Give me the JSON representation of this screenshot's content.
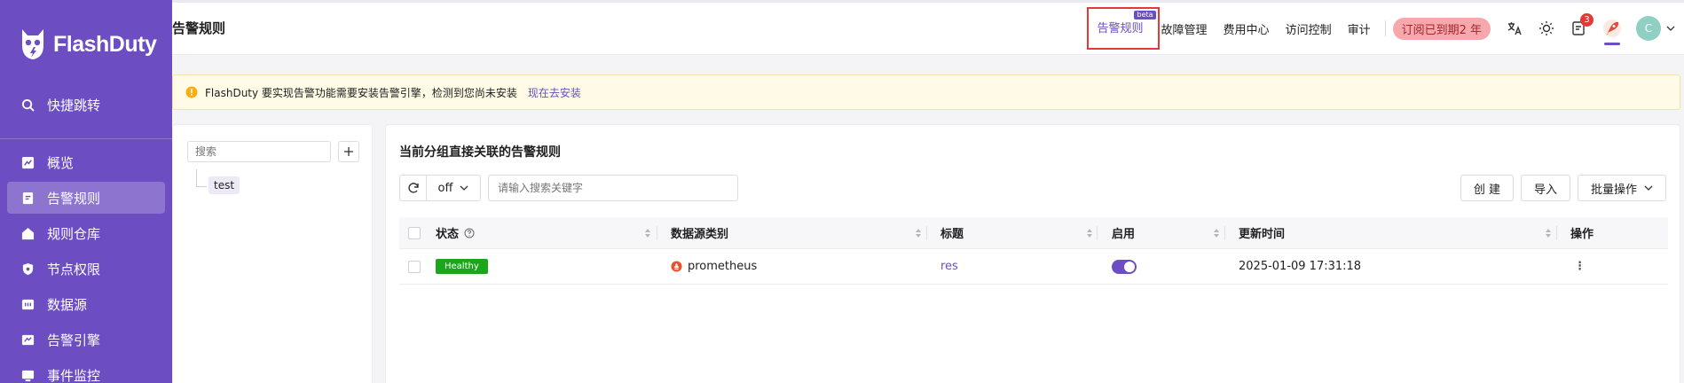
{
  "brand": {
    "name": "FlashDuty"
  },
  "sidebar": {
    "search_label": "快捷跳转",
    "items": [
      {
        "label": "概览",
        "icon": "chart-icon"
      },
      {
        "label": "告警规则",
        "icon": "rule-doc-icon",
        "active": true
      },
      {
        "label": "规则仓库",
        "icon": "warehouse-icon"
      },
      {
        "label": "节点权限",
        "icon": "shield-icon"
      },
      {
        "label": "数据源",
        "icon": "datasource-icon"
      },
      {
        "label": "告警引擎",
        "icon": "engine-icon"
      },
      {
        "label": "事件监控",
        "icon": "monitor-icon"
      }
    ]
  },
  "header": {
    "title": "告警规则",
    "nav": {
      "alert_rules": "告警规则",
      "beta": "beta",
      "incident_mgmt": "故障管理",
      "billing": "费用中心",
      "access_control": "访问控制",
      "audit": "审计"
    },
    "subscription": "订阅已到期2 年",
    "notification_count": "3",
    "user_initial": "C"
  },
  "alert": {
    "message": "FlashDuty 要实现告警功能需要安装告警引擎，检测到您尚未安装",
    "link": "现在去安装"
  },
  "tree": {
    "search_placeholder": "搜索",
    "nodes": [
      "test"
    ]
  },
  "main": {
    "title": "当前分组直接关联的告警规则",
    "refresh_select": "off",
    "search_placeholder": "请输入搜索关键字",
    "buttons": {
      "create": "创 建",
      "import": "导入",
      "batch": "批量操作"
    },
    "columns": {
      "status": "状态",
      "datasource_type": "数据源类别",
      "title": "标题",
      "enabled": "启用",
      "updated_at": "更新时间",
      "actions": "操作"
    },
    "rows": [
      {
        "status": "Healthy",
        "datasource": "prometheus",
        "title": "res",
        "enabled": true,
        "updated_at": "2025-01-09 17:31:18",
        "action": "⋮"
      }
    ]
  },
  "colors": {
    "brand_purple": "#6c4ec2",
    "healthy_green": "#1aa81a",
    "badge_red": "#e53935",
    "prometheus_orange": "#e6522c"
  }
}
